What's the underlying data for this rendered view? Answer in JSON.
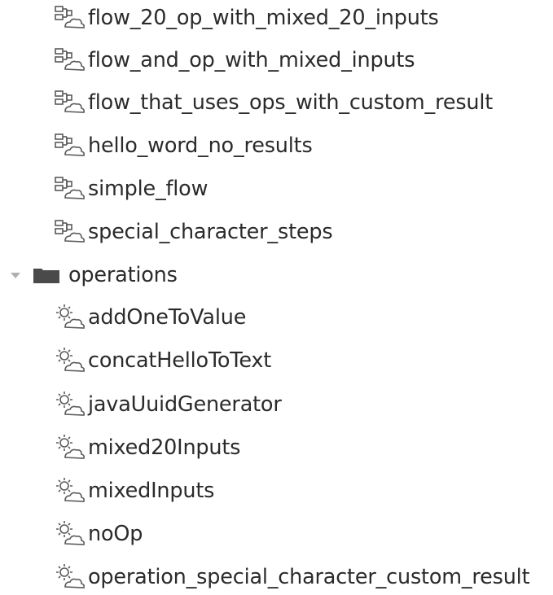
{
  "tree": {
    "flows": [
      {
        "label": "flow_20_op_with_mixed_20_inputs",
        "icon": "flow-icon"
      },
      {
        "label": "flow_and_op_with_mixed_inputs",
        "icon": "flow-icon"
      },
      {
        "label": "flow_that_uses_ops_with_custom_result",
        "icon": "flow-icon"
      },
      {
        "label": "hello_word_no_results",
        "icon": "flow-icon"
      },
      {
        "label": "simple_flow",
        "icon": "flow-icon"
      },
      {
        "label": "special_character_steps",
        "icon": "flow-icon"
      }
    ],
    "operations_folder": {
      "label": "operations",
      "icon": "folder-icon",
      "expanded": true,
      "caret_icon": "caret-down-icon"
    },
    "operations": [
      {
        "label": "addOneToValue",
        "icon": "operation-icon"
      },
      {
        "label": "concatHelloToText",
        "icon": "operation-icon"
      },
      {
        "label": "javaUuidGenerator",
        "icon": "operation-icon"
      },
      {
        "label": "mixed20Inputs",
        "icon": "operation-icon"
      },
      {
        "label": "mixedInputs",
        "icon": "operation-icon"
      },
      {
        "label": "noOp",
        "icon": "operation-icon"
      },
      {
        "label": "operation_special_character_custom_result",
        "icon": "operation-icon"
      }
    ]
  },
  "colors": {
    "text": "#2b2b2b",
    "icon": "#5a5a5a",
    "folder": "#4a4a4a",
    "caret": "#b0b0b0"
  }
}
